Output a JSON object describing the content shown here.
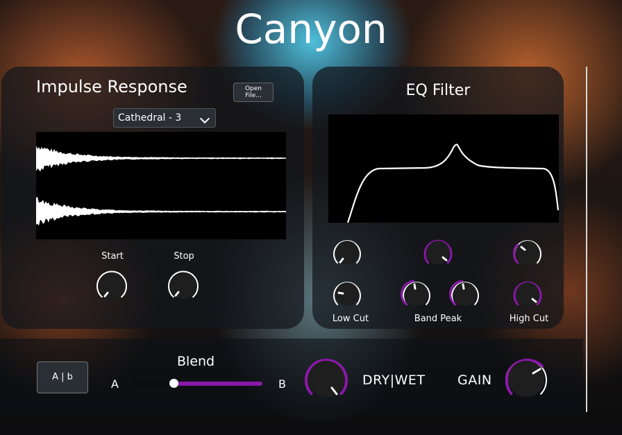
{
  "app": {
    "title": "Canyon"
  },
  "impulse_response": {
    "title": "Impulse Response",
    "open_file_line1": "Open",
    "open_file_line2": "File...",
    "preset": "Cathedral - 3",
    "start_label": "Start",
    "stop_label": "Stop",
    "start_value": 0.05,
    "stop_value": 0.1
  },
  "eq_filter": {
    "title": "EQ Filter",
    "low_cut_label": "Low Cut",
    "band_peak_label": "Band Peak",
    "high_cut_label": "High Cut"
  },
  "bottom": {
    "ab_button": "A | b",
    "blend_label": "Blend",
    "blend_a": "A",
    "blend_b": "B",
    "blend_value": 0.33,
    "drywet_label": "DRY|WET",
    "gain_label": "GAIN"
  },
  "colors": {
    "accent": "#8a18a8",
    "knob_body": "#1e1e1e",
    "panel": "#12161c"
  }
}
